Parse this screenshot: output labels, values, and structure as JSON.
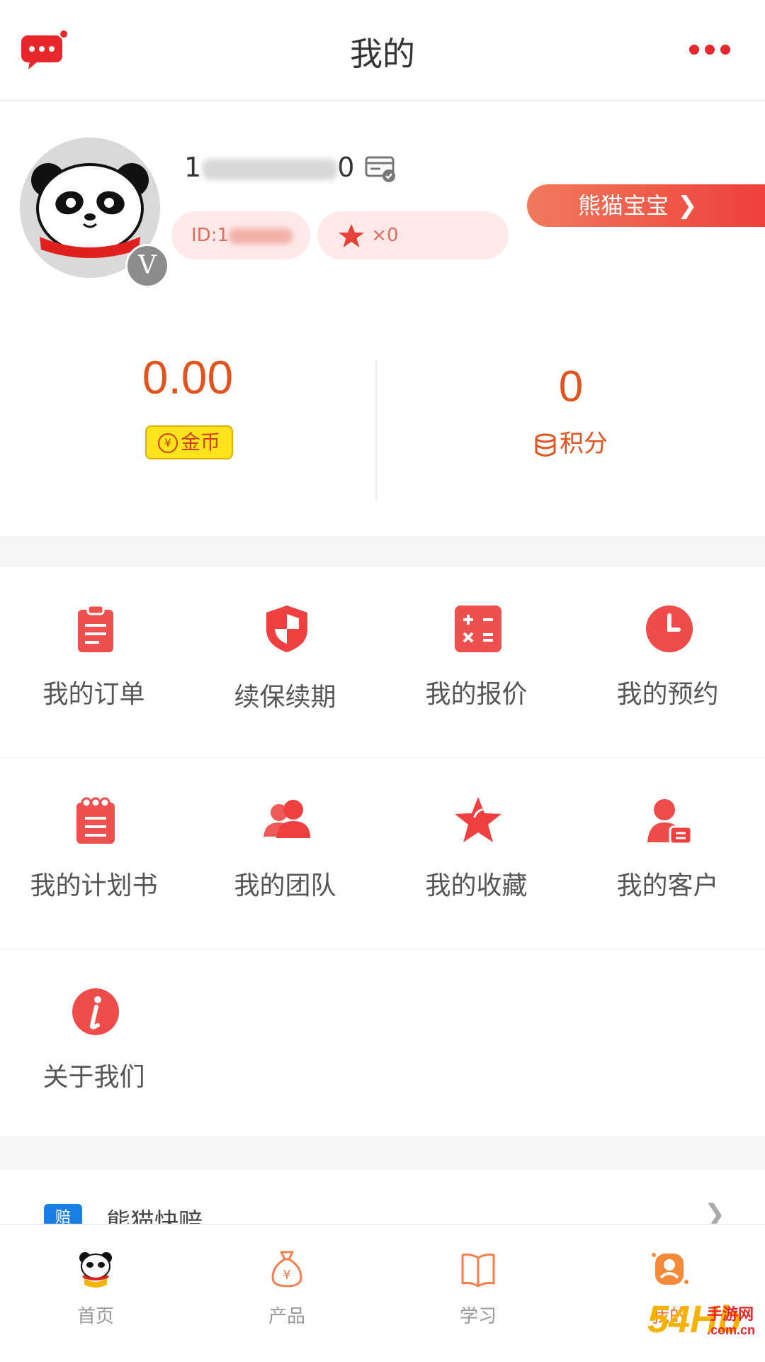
{
  "header": {
    "title": "我的",
    "message_icon": "message-icon",
    "more_icon": "more-icon"
  },
  "profile": {
    "phone_visible_start": "1",
    "phone_visible_end": "0",
    "id_prefix": "ID:1",
    "star_count": "×0",
    "panda_button_label": "熊猫宝宝",
    "verified_badge": "V"
  },
  "stats": {
    "coins_value": "0.00",
    "coins_label": "金币",
    "coins_symbol": "¥",
    "points_value": "0",
    "points_label": "积分"
  },
  "menu": [
    {
      "label": "我的订单",
      "icon": "clipboard-icon"
    },
    {
      "label": "续保续期",
      "icon": "shield-icon"
    },
    {
      "label": "我的报价",
      "icon": "calculator-icon"
    },
    {
      "label": "我的预约",
      "icon": "clock-icon"
    },
    {
      "label": "我的计划书",
      "icon": "notepad-icon"
    },
    {
      "label": "我的团队",
      "icon": "team-icon"
    },
    {
      "label": "我的收藏",
      "icon": "star-icon"
    },
    {
      "label": "我的客户",
      "icon": "customer-icon"
    },
    {
      "label": "关于我们",
      "icon": "info-icon"
    }
  ],
  "quick_link": {
    "icon_text": "赔",
    "label": "熊猫快赔"
  },
  "tabs": [
    {
      "label": "首页",
      "icon": "panda-home-icon"
    },
    {
      "label": "产品",
      "icon": "money-bag-icon"
    },
    {
      "label": "学习",
      "icon": "book-icon"
    },
    {
      "label": "我的",
      "icon": "profile-icon",
      "active": true
    }
  ],
  "watermark": {
    "text": "54Hb",
    "sub": "手游网",
    "domain": ".com.cn"
  },
  "colors": {
    "accent": "#ee4b4b",
    "orange": "#e0541f",
    "tab_active": "#f07333"
  }
}
